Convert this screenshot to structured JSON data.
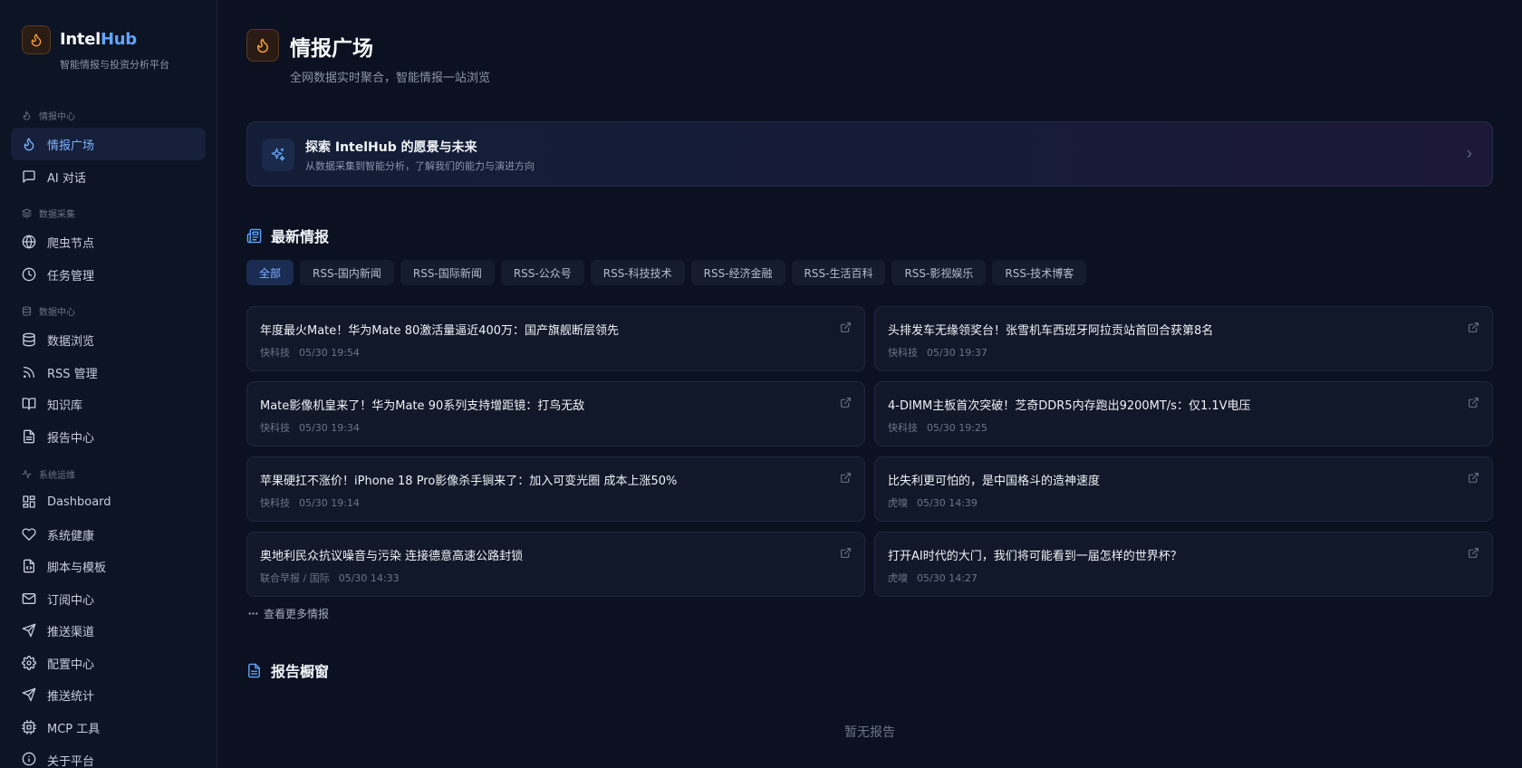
{
  "brand": {
    "name_a": "Intel",
    "name_b": "Hub",
    "subtitle": "智能情报与投资分析平台"
  },
  "sidebar": {
    "sections": [
      {
        "label": "情报中心",
        "icon": "flame-icon"
      },
      {
        "label": "数据采集",
        "icon": "layers-icon"
      },
      {
        "label": "数据中心",
        "icon": "database-icon"
      },
      {
        "label": "系统运维",
        "icon": "activity-icon"
      }
    ],
    "items": [
      {
        "label": "情报广场",
        "icon": "flame-icon",
        "active": true
      },
      {
        "label": "AI 对话",
        "icon": "message-icon"
      },
      {
        "label": "爬虫节点",
        "icon": "globe-icon"
      },
      {
        "label": "任务管理",
        "icon": "clock-icon"
      },
      {
        "label": "数据浏览",
        "icon": "database-icon"
      },
      {
        "label": "RSS 管理",
        "icon": "rss-icon"
      },
      {
        "label": "知识库",
        "icon": "book-icon"
      },
      {
        "label": "报告中心",
        "icon": "file-text-icon"
      },
      {
        "label": "Dashboard",
        "icon": "dashboard-icon"
      },
      {
        "label": "系统健康",
        "icon": "heart-icon"
      },
      {
        "label": "脚本与模板",
        "icon": "file-code-icon"
      },
      {
        "label": "订阅中心",
        "icon": "mail-icon"
      },
      {
        "label": "推送渠道",
        "icon": "send-icon"
      },
      {
        "label": "配置中心",
        "icon": "gear-icon"
      },
      {
        "label": "推送统计",
        "icon": "send-icon"
      },
      {
        "label": "MCP 工具",
        "icon": "cpu-icon"
      },
      {
        "label": "关于平台",
        "icon": "info-icon"
      }
    ]
  },
  "header": {
    "title": "情报广场",
    "subtitle": "全网数据实时聚合，智能情报一站浏览"
  },
  "banner": {
    "title": "探索 IntelHub 的愿景与未来",
    "subtitle": "从数据采集到智能分析，了解我们的能力与演进方向"
  },
  "latest": {
    "title": "最新情报",
    "tabs": [
      "全部",
      "RSS-国内新闻",
      "RSS-国际新闻",
      "RSS-公众号",
      "RSS-科技技术",
      "RSS-经济金融",
      "RSS-生活百科",
      "RSS-影视娱乐",
      "RSS-技术博客"
    ],
    "active_tab": 0,
    "items": [
      {
        "title": "年度最火Mate！华为Mate 80激活量逼近400万：国产旗舰断层领先",
        "source": "快科技",
        "time": "05/30 19:54"
      },
      {
        "title": "头排发车无缘领奖台！张雪机车西班牙阿拉贡站首回合获第8名",
        "source": "快科技",
        "time": "05/30 19:37"
      },
      {
        "title": "Mate影像机皇来了！华为Mate 90系列支持增距镜：打鸟无敌",
        "source": "快科技",
        "time": "05/30 19:34"
      },
      {
        "title": "4-DIMM主板首次突破！芝奇DDR5内存跑出9200MT/s：仅1.1V电压",
        "source": "快科技",
        "time": "05/30 19:25"
      },
      {
        "title": "苹果硬扛不涨价！iPhone 18 Pro影像杀手锏来了：加入可变光圈 成本上涨50%",
        "source": "快科技",
        "time": "05/30 19:14"
      },
      {
        "title": "比失利更可怕的，是中国格斗的造神速度",
        "source": "虎嗅",
        "time": "05/30 14:39"
      },
      {
        "title": "奥地利民众抗议噪音与污染 连接德意高速公路封锁",
        "source": "联合早报 / 国际",
        "time": "05/30 14:33"
      },
      {
        "title": "打开AI时代的大门，我们将可能看到一届怎样的世界杯？",
        "source": "虎嗅",
        "time": "05/30 14:27"
      }
    ],
    "more_label": "查看更多情报"
  },
  "reports": {
    "title": "报告橱窗",
    "empty": "暂无报告"
  },
  "colors": {
    "accent": "#60a5fa",
    "flame": "#f59e3b",
    "background": "#0b1120"
  }
}
